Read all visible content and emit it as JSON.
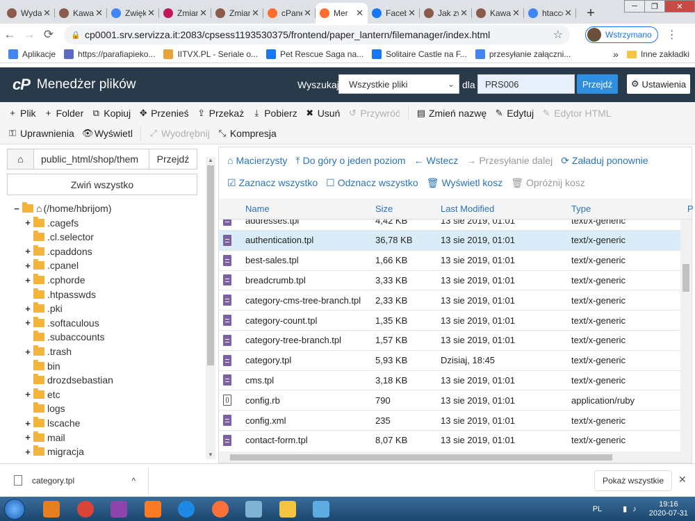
{
  "browser": {
    "tabs": [
      {
        "title": "Wydajn",
        "color": "#8b5a4a"
      },
      {
        "title": "Kawa zi",
        "color": "#8b5a4a"
      },
      {
        "title": "Zwiększ",
        "color": "#4285f4"
      },
      {
        "title": "Zmiana",
        "color": "#c2185b"
      },
      {
        "title": "Zmiana",
        "color": "#8b5a4a"
      },
      {
        "title": "cPanel",
        "color": "#ff6c2c"
      },
      {
        "title": "Mer",
        "color": "#ff6c2c"
      },
      {
        "title": "Facebo",
        "color": "#1877f2"
      },
      {
        "title": "Jak zwi",
        "color": "#8b5a4a"
      },
      {
        "title": "Kawa zi",
        "color": "#8b5a4a"
      },
      {
        "title": "htacces",
        "color": "#4285f4"
      }
    ],
    "active_tab_index": 6,
    "tab_close_glyph": "✕",
    "new_tab_glyph": "+",
    "window_controls": [
      "─",
      "❐",
      "✕"
    ],
    "url": "cp0001.srv.servizza.it:2083/cpsess1193530375/frontend/paper_lantern/filemanager/index.html",
    "profile_label": "Wstrzymano",
    "bookmarks": [
      {
        "label": "Aplikacje",
        "color": "#4285f4"
      },
      {
        "label": "https://parafiapieko...",
        "color": "#5c6bc0"
      },
      {
        "label": "IITVX.PL - Seriale o...",
        "color": "#e8a33d"
      },
      {
        "label": "Pet Rescue Saga na...",
        "color": "#1877f2"
      },
      {
        "label": "Solitaire Castle na F...",
        "color": "#1877f2"
      },
      {
        "label": "przesyłanie załączni...",
        "color": "#4285f4"
      }
    ],
    "bookmarks_more": "»",
    "bookmarks_other": "Inne zakładki"
  },
  "cpanel": {
    "logo": "cP",
    "title": "Menedżer plików",
    "search_label": "Wyszukaj",
    "search_scope": "Wszystkie pliki",
    "for_label": "dla",
    "search_value": "PRS006",
    "go_label": "Przejdź",
    "settings_label": "Ustawienia"
  },
  "toolbar": {
    "row1": [
      {
        "icon": "+",
        "label": "Plik",
        "enabled": true
      },
      {
        "icon": "+",
        "label": "Folder",
        "enabled": true
      },
      {
        "icon": "⧉",
        "label": "Kopiuj",
        "enabled": true
      },
      {
        "icon": "✥",
        "label": "Przenieś",
        "enabled": true
      },
      {
        "icon": "⇪",
        "label": "Przekaż",
        "enabled": true
      },
      {
        "icon": "⤓",
        "label": "Pobierz",
        "enabled": true
      },
      {
        "icon": "✖",
        "label": "Usuń",
        "enabled": true
      },
      {
        "icon": "↺",
        "label": "Przywróć",
        "enabled": false
      },
      {
        "icon": "▤",
        "label": "Zmień nazwę",
        "enabled": true
      },
      {
        "icon": "✎",
        "label": "Edytuj",
        "enabled": true
      },
      {
        "icon": "✎",
        "label": "Edytor HTML",
        "enabled": false
      }
    ],
    "row2": [
      {
        "icon": "⚿",
        "label": "Uprawnienia",
        "enabled": true
      },
      {
        "icon": "👁",
        "label": "Wyświetl",
        "enabled": true
      },
      {
        "icon": "⤢",
        "label": "Wyodrębnij",
        "enabled": false
      },
      {
        "icon": "⤡",
        "label": "Kompresja",
        "enabled": true
      }
    ]
  },
  "left": {
    "path": "public_html/shop/them",
    "go_label": "Przejdź",
    "collapse_label": "Zwiń wszystko",
    "root_label": "(/home/hbrijom)",
    "tree": [
      {
        "label": ".cagefs",
        "exp": "+"
      },
      {
        "label": ".cl.selector",
        "exp": ""
      },
      {
        "label": ".cpaddons",
        "exp": "+"
      },
      {
        "label": ".cpanel",
        "exp": "+"
      },
      {
        "label": ".cphorde",
        "exp": "+"
      },
      {
        "label": ".htpasswds",
        "exp": ""
      },
      {
        "label": ".pki",
        "exp": "+"
      },
      {
        "label": ".softaculous",
        "exp": "+"
      },
      {
        "label": ".subaccounts",
        "exp": ""
      },
      {
        "label": ".trash",
        "exp": "+"
      },
      {
        "label": "bin",
        "exp": ""
      },
      {
        "label": "drozdsebastian",
        "exp": ""
      },
      {
        "label": "etc",
        "exp": "+"
      },
      {
        "label": "logs",
        "exp": ""
      },
      {
        "label": "lscache",
        "exp": "+"
      },
      {
        "label": "mail",
        "exp": "+"
      },
      {
        "label": "migracja",
        "exp": "+"
      }
    ]
  },
  "right": {
    "nav1": [
      {
        "icon": "⌂",
        "label": "Macierzysty",
        "enabled": true
      },
      {
        "icon": "⤒",
        "label": "Do góry o jeden poziom",
        "enabled": true
      },
      {
        "icon": "←",
        "label": "Wstecz",
        "enabled": true
      },
      {
        "icon": "→",
        "label": "Przesyłanie dalej",
        "enabled": false
      },
      {
        "icon": "⟳",
        "label": "Załaduj ponownie",
        "enabled": true
      }
    ],
    "nav2": [
      {
        "icon": "☑",
        "label": "Zaznacz wszystko",
        "enabled": true
      },
      {
        "icon": "☐",
        "label": "Odznacz wszystko",
        "enabled": true
      },
      {
        "icon": "🗑",
        "label": "Wyświetl kosz",
        "enabled": true
      },
      {
        "icon": "🗑",
        "label": "Opróżnij kosz",
        "enabled": false
      }
    ],
    "columns": {
      "name": "Name",
      "size": "Size",
      "modified": "Last Modified",
      "type": "Type",
      "perm": "P"
    },
    "files": [
      {
        "name": "addresses.tpl",
        "size": "4,42 KB",
        "modified": "13 sie 2019, 01:01",
        "type": "text/x-generic",
        "icon": "text",
        "selected": false
      },
      {
        "name": "authentication.tpl",
        "size": "36,78 KB",
        "modified": "13 sie 2019, 01:01",
        "type": "text/x-generic",
        "icon": "text",
        "selected": true
      },
      {
        "name": "best-sales.tpl",
        "size": "1,66 KB",
        "modified": "13 sie 2019, 01:01",
        "type": "text/x-generic",
        "icon": "text",
        "selected": false
      },
      {
        "name": "breadcrumb.tpl",
        "size": "3,33 KB",
        "modified": "13 sie 2019, 01:01",
        "type": "text/x-generic",
        "icon": "text",
        "selected": false
      },
      {
        "name": "category-cms-tree-branch.tpl",
        "size": "2,33 KB",
        "modified": "13 sie 2019, 01:01",
        "type": "text/x-generic",
        "icon": "text",
        "selected": false
      },
      {
        "name": "category-count.tpl",
        "size": "1,35 KB",
        "modified": "13 sie 2019, 01:01",
        "type": "text/x-generic",
        "icon": "text",
        "selected": false
      },
      {
        "name": "category-tree-branch.tpl",
        "size": "1,57 KB",
        "modified": "13 sie 2019, 01:01",
        "type": "text/x-generic",
        "icon": "text",
        "selected": false
      },
      {
        "name": "category.tpl",
        "size": "5,93 KB",
        "modified": "Dzisiaj, 18:45",
        "type": "text/x-generic",
        "icon": "text",
        "selected": false
      },
      {
        "name": "cms.tpl",
        "size": "3,18 KB",
        "modified": "13 sie 2019, 01:01",
        "type": "text/x-generic",
        "icon": "text",
        "selected": false
      },
      {
        "name": "config.rb",
        "size": "790",
        "modified": "13 sie 2019, 01:01",
        "type": "application/ruby",
        "icon": "code",
        "selected": false
      },
      {
        "name": "config.xml",
        "size": "235",
        "modified": "13 sie 2019, 01:01",
        "type": "text/x-generic",
        "icon": "text",
        "selected": false
      },
      {
        "name": "contact-form.tpl",
        "size": "8,07 KB",
        "modified": "13 sie 2019, 01:01",
        "type": "text/x-generic",
        "icon": "text",
        "selected": false
      }
    ]
  },
  "download_bar": {
    "file": "category.tpl",
    "chevron": "^",
    "show_all": "Pokaż wszystkie",
    "close": "✕"
  },
  "taskbar": {
    "apps": [
      {
        "name": "media-player",
        "color": "#e67e22"
      },
      {
        "name": "chrome",
        "color": "#db4437"
      },
      {
        "name": "winrar",
        "color": "#8e44ad"
      },
      {
        "name": "xampp",
        "color": "#fb7a24"
      },
      {
        "name": "internet-explorer",
        "color": "#1e88e5"
      },
      {
        "name": "firefox",
        "color": "#ff7139"
      },
      {
        "name": "notepad",
        "color": "#7fb3d5"
      },
      {
        "name": "explorer",
        "color": "#f5c542"
      },
      {
        "name": "photos",
        "color": "#5dade2"
      }
    ],
    "lang": "PL",
    "time": "19:16",
    "date": "2020-07-31"
  }
}
